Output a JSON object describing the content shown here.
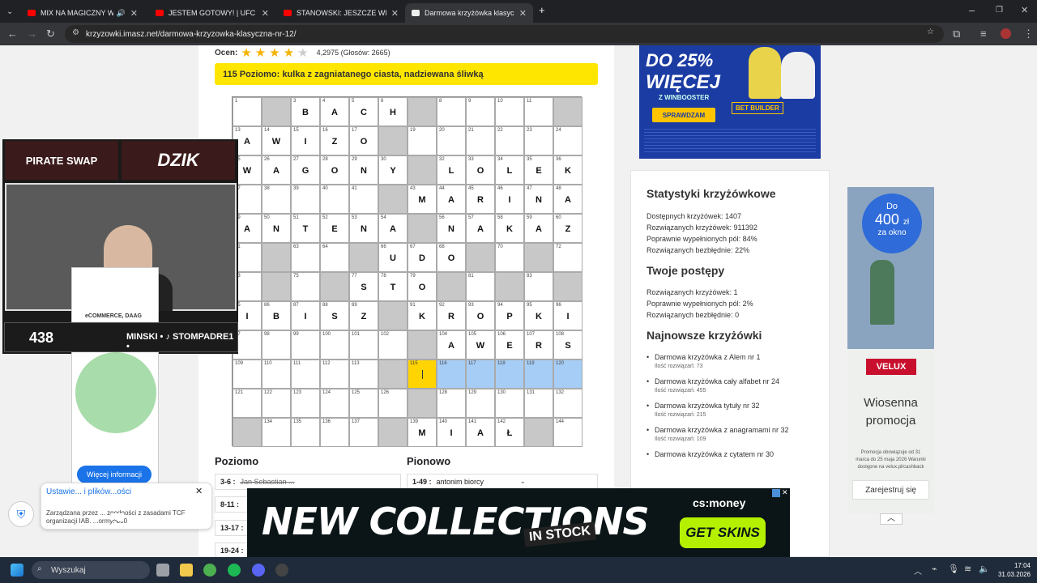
{
  "tabs": [
    {
      "title": "MIX NA MAGICZNY WIECZ"
    },
    {
      "title": "JESTEM GOTOWY! | UFC FIGHT"
    },
    {
      "title": "STANOWSKI: JESZCZE WIĘCEJ"
    },
    {
      "title": "Darmowa krzyżówka klasyczna"
    }
  ],
  "address": "krzyzowki.imasz.net/darmowa-krzyzowka-klasyczna-nr-12/",
  "rating": {
    "label": "Ocen:",
    "value": "4,2975 (Głosów: 2665)",
    "stars": 4
  },
  "current_clue": "115 Poziomo: kulka z zagniatanego ciasta, nadziewana śliwką",
  "grid": {
    "rows": [
      [
        {
          "n": "1"
        },
        {
          "b": 1
        },
        {
          "n": "3",
          "l": "B"
        },
        {
          "n": "4",
          "l": "A"
        },
        {
          "n": "5",
          "l": "C"
        },
        {
          "n": "6",
          "l": "H"
        },
        {
          "b": 1
        },
        {
          "n": "8"
        },
        {
          "n": "9"
        },
        {
          "n": "10"
        },
        {
          "n": "11"
        },
        {
          "b": 1
        }
      ],
      [
        {
          "n": "13",
          "l": "A"
        },
        {
          "n": "14",
          "l": "W"
        },
        {
          "n": "15",
          "l": "I"
        },
        {
          "n": "16",
          "l": "Z"
        },
        {
          "n": "17",
          "l": "O"
        },
        {
          "b": 1
        },
        {
          "n": "19"
        },
        {
          "n": "20"
        },
        {
          "n": "21"
        },
        {
          "n": "22"
        },
        {
          "n": "23"
        },
        {
          "n": "24"
        }
      ],
      [
        {
          "n": "25",
          "l": "W"
        },
        {
          "n": "26",
          "l": "A"
        },
        {
          "n": "27",
          "l": "G"
        },
        {
          "n": "28",
          "l": "O"
        },
        {
          "n": "29",
          "l": "N"
        },
        {
          "n": "30",
          "l": "Y"
        },
        {
          "b": 1
        },
        {
          "n": "32",
          "l": "L"
        },
        {
          "n": "33",
          "l": "O"
        },
        {
          "n": "34",
          "l": "L"
        },
        {
          "n": "35",
          "l": "E"
        },
        {
          "n": "36",
          "l": "K"
        }
      ],
      [
        {
          "n": "37"
        },
        {
          "n": "38"
        },
        {
          "n": "39"
        },
        {
          "n": "40"
        },
        {
          "n": "41"
        },
        {
          "b": 1
        },
        {
          "n": "43",
          "l": "M"
        },
        {
          "n": "44",
          "l": "A"
        },
        {
          "n": "45",
          "l": "R"
        },
        {
          "n": "46",
          "l": "I"
        },
        {
          "n": "47",
          "l": "N"
        },
        {
          "n": "48",
          "l": "A"
        }
      ],
      [
        {
          "n": "49",
          "l": "A"
        },
        {
          "n": "50",
          "l": "N"
        },
        {
          "n": "51",
          "l": "T"
        },
        {
          "n": "52",
          "l": "E"
        },
        {
          "n": "53",
          "l": "N"
        },
        {
          "n": "54",
          "l": "A"
        },
        {
          "b": 1
        },
        {
          "n": "56",
          "l": "N"
        },
        {
          "n": "57",
          "l": "A"
        },
        {
          "n": "58",
          "l": "K"
        },
        {
          "n": "59",
          "l": "A"
        },
        {
          "n": "60",
          "l": "Z"
        }
      ],
      [
        {
          "n": "61"
        },
        {
          "b": 1
        },
        {
          "n": "63"
        },
        {
          "n": "64"
        },
        {
          "b": 1
        },
        {
          "n": "66",
          "l": "U"
        },
        {
          "n": "67",
          "l": "D"
        },
        {
          "n": "68",
          "l": "O"
        },
        {
          "b": 1
        },
        {
          "n": "70"
        },
        {
          "b": 1
        },
        {
          "n": "72"
        }
      ],
      [
        {
          "n": "73"
        },
        {
          "b": 1
        },
        {
          "n": "75"
        },
        {
          "b": 1
        },
        {
          "n": "77",
          "l": "S"
        },
        {
          "n": "78",
          "l": "T"
        },
        {
          "n": "79",
          "l": "O"
        },
        {
          "b": 1
        },
        {
          "n": "81"
        },
        {
          "b": 1
        },
        {
          "n": "83"
        },
        {
          "b": 1
        }
      ],
      [
        {
          "n": "85",
          "l": "I"
        },
        {
          "n": "86",
          "l": "B"
        },
        {
          "n": "87",
          "l": "I"
        },
        {
          "n": "88",
          "l": "S"
        },
        {
          "n": "89",
          "l": "Z"
        },
        {
          "b": 1
        },
        {
          "n": "91",
          "l": "K"
        },
        {
          "n": "92",
          "l": "R"
        },
        {
          "n": "93",
          "l": "O"
        },
        {
          "n": "94",
          "l": "P"
        },
        {
          "n": "95",
          "l": "K"
        },
        {
          "n": "96",
          "l": "I"
        }
      ],
      [
        {
          "n": "97"
        },
        {
          "n": "98"
        },
        {
          "n": "99"
        },
        {
          "n": "100"
        },
        {
          "n": "101"
        },
        {
          "n": "102"
        },
        {
          "b": 1
        },
        {
          "n": "104",
          "l": "A"
        },
        {
          "n": "105",
          "l": "W"
        },
        {
          "n": "106",
          "l": "E"
        },
        {
          "n": "107",
          "l": "R"
        },
        {
          "n": "108",
          "l": "S"
        }
      ],
      [
        {
          "n": "109"
        },
        {
          "n": "110"
        },
        {
          "n": "111"
        },
        {
          "n": "112"
        },
        {
          "n": "113"
        },
        {
          "b": 1
        },
        {
          "n": "115",
          "cur": 1
        },
        {
          "n": "116",
          "h": 1
        },
        {
          "n": "117",
          "h": 1
        },
        {
          "n": "118",
          "h": 1
        },
        {
          "n": "119",
          "h": 1
        },
        {
          "n": "120",
          "h": 1
        }
      ],
      [
        {
          "n": "121"
        },
        {
          "n": "122"
        },
        {
          "n": "123"
        },
        {
          "n": "124"
        },
        {
          "n": "125"
        },
        {
          "n": "126"
        },
        {
          "b": 1
        },
        {
          "n": "128"
        },
        {
          "n": "129"
        },
        {
          "n": "130"
        },
        {
          "n": "131"
        },
        {
          "n": "132"
        }
      ],
      [
        {
          "b": 1
        },
        {
          "n": "134"
        },
        {
          "n": "135"
        },
        {
          "n": "136"
        },
        {
          "n": "137"
        },
        {
          "b": 1
        },
        {
          "n": "139",
          "l": "M"
        },
        {
          "n": "140",
          "l": "I"
        },
        {
          "n": "141",
          "l": "A"
        },
        {
          "n": "142",
          "l": "Ł"
        },
        {
          "b": 1
        },
        {
          "n": "144"
        }
      ]
    ]
  },
  "clues": {
    "poziomo_title": "Poziomo",
    "pionowo_title": "Pionowo",
    "poziomo": [
      {
        "num": "3-6 :",
        "text": "Jan Sebastian ..."
      },
      {
        "num": "8-11 :",
        "text": ""
      },
      {
        "num": "13-17 :",
        "text": ""
      },
      {
        "num": "19-24 :",
        "text": ""
      }
    ],
    "pionowo": [
      {
        "num": "1-49 :",
        "text": "antonim biorcy"
      }
    ]
  },
  "ad_top": {
    "big": "DO 25%",
    "big2": "WIĘCEJ",
    "brand": "Z WINBOOSTER",
    "cta": "SPRAWDZAM",
    "tag": "BET BUILDER"
  },
  "stats": {
    "title": "Statystyki krzyżówkowe",
    "lines": [
      "Dostępnych krzyżówek: 1407",
      "Rozwiązanych krzyżówek: 911392",
      "Poprawnie wypełnionych pól: 84%",
      "Rozwiązanych bezbłędnie: 22%"
    ],
    "progress_title": "Twoje postępy",
    "progress_lines": [
      "Rozwiązanych krzyżówek: 1",
      "Poprawnie wypełnionych pól: 2%",
      "Rozwiązanych bezbłędnie: 0"
    ],
    "recent_title": "Najnowsze krzyżówki",
    "recent": [
      {
        "title": "Darmowa krzyżówka z Alem nr 1",
        "count": "Ilość rozwiązań: 73"
      },
      {
        "title": "Darmowa krzyżówka cały alfabet nr 24",
        "count": "Ilość rozwiązań: 455"
      },
      {
        "title": "Darmowa krzyżówka tytuły nr 32",
        "count": "Ilość rozwiązań: 215"
      },
      {
        "title": "Darmowa krzyżówka z anagramami nr 32",
        "count": "Ilość rozwiązań: 109"
      },
      {
        "title": "Darmowa krzyżówka z cytatem nr 30",
        "count": ""
      }
    ]
  },
  "ad_right": {
    "do": "Do",
    "amount": "400",
    "zl": "zł",
    "sub": "za okno",
    "brand": "VELUX",
    "promo1": "Wiosenna",
    "promo2": "promocja",
    "small": "Promocja obowiązuje od 31 marca do 25 maja 2026 Warunki dostępne na velux.pl/cashback",
    "cta": "Zarejestruj się"
  },
  "stream": {
    "sponsor1": "PIRATE SWAP",
    "sponsor2": "DZIK",
    "count": "438",
    "ticker": "MINSKI • ♪ STOMPADRE1 •"
  },
  "left_card": {
    "label": "eCOMMERCE, DAAG",
    "cta": "Więcej informacji"
  },
  "cookie": {
    "title": "Ustawie... i plików...ości",
    "body": "Zarządzana przez ... zgodności z zasadami TCF organizacji IAB. ...ormy: 300"
  },
  "bottom_ad": {
    "headline": "NEW COLLECTIONS",
    "badge": "IN STOCK",
    "brand": "cs:money",
    "cta": "GET SKINS"
  },
  "taskbar": {
    "search": "Wyszukaj",
    "time": "17:04",
    "date": "31.03.2026"
  }
}
